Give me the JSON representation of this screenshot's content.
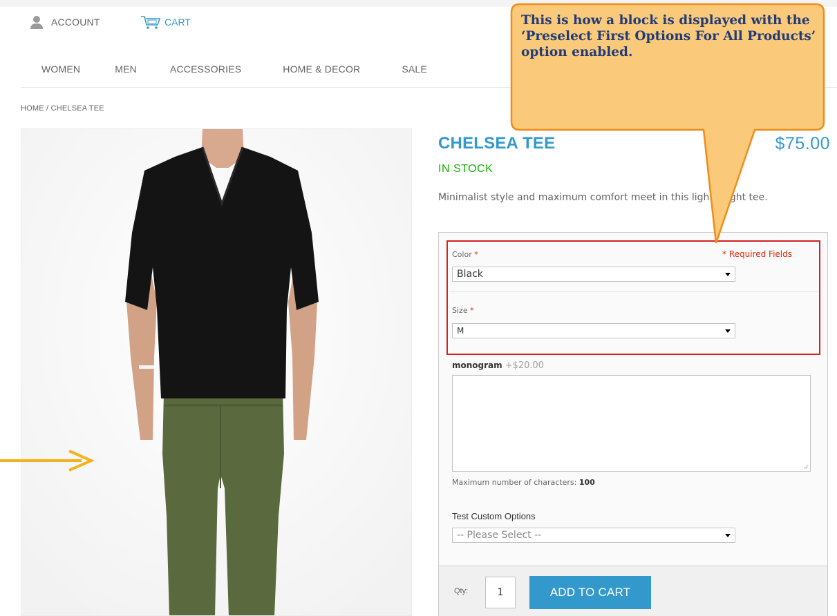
{
  "header": {
    "account_label": "ACCOUNT",
    "cart_label": "CART",
    "icons": [
      "user-icon",
      "cart-icon"
    ]
  },
  "nav": {
    "items": [
      "WOMEN",
      "MEN",
      "ACCESSORIES",
      "HOME & DECOR",
      "SALE"
    ]
  },
  "breadcrumb": "HOME / CHELSEA TEE",
  "product": {
    "title": "CHELSEA TEE",
    "price": "$75.00",
    "stock": "IN STOCK",
    "description": "Minimalist style and maximum comfort meet in this lightweight tee."
  },
  "options": {
    "required_note": "* Required Fields",
    "color": {
      "label": "Color",
      "star": "*",
      "value": "Black"
    },
    "size": {
      "label": "Size",
      "star": "*",
      "value": "M"
    },
    "monogram": {
      "label": "monogram",
      "price": "+$20.00"
    },
    "max_chars": {
      "label": "Maximum number of characters:",
      "value": "100"
    },
    "test": {
      "label": "Test Custom Options",
      "value": "-- Please Select --"
    }
  },
  "cart": {
    "qty_label": "Qty:",
    "qty_value": "1",
    "button_label": "ADD TO CART"
  },
  "annotation": {
    "text": "This is how a block is displayed with the ‘Preselect First Options For All Products’ option enabled."
  },
  "colors": {
    "accent": "#3399cc",
    "stock": "#11b400",
    "required": "#df280a",
    "highlight_box": "#d42121",
    "callout_fill": "#fbc97a",
    "callout_border": "#f08c1a",
    "arrow": "#f5b21a"
  }
}
